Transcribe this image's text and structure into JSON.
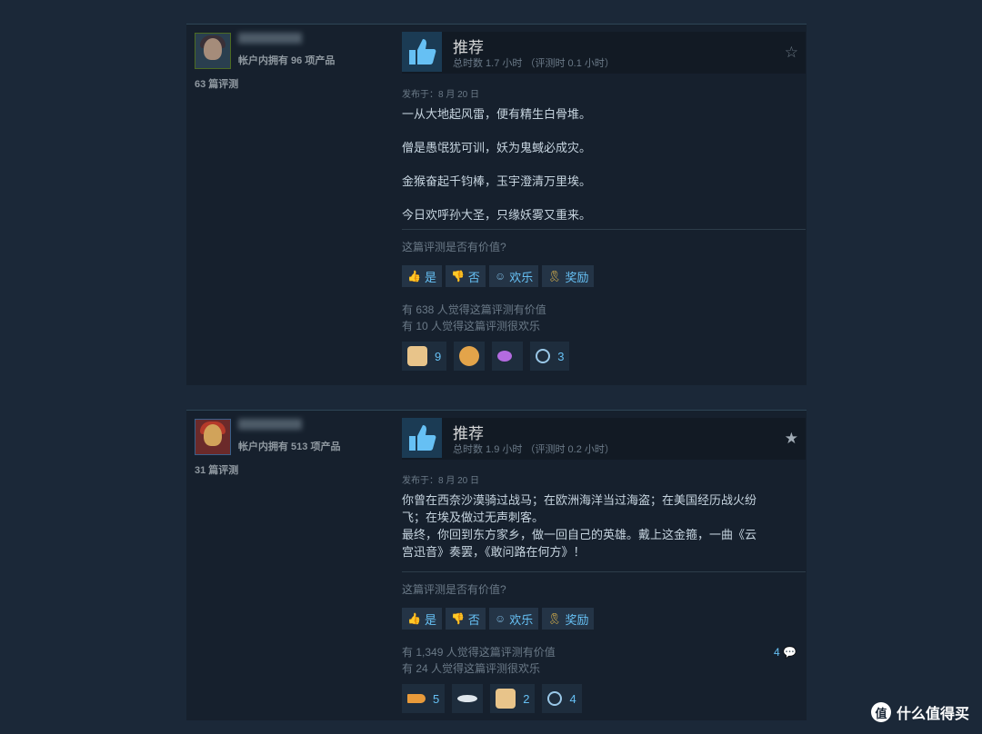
{
  "reviews": [
    {
      "owned": "帐户内拥有 96 项产品",
      "review_count": "63 篇评测",
      "verdict": "推荐",
      "hours": "总时数 1.7 小时 （评测时 0.1 小时）",
      "posted": "发布于：8 月 20 日",
      "lines": [
        "一从大地起风雷，便有精生白骨堆。",
        "僧是愚氓犹可训，妖为鬼蜮必成灾。",
        "金猴奋起千钧棒，玉宇澄清万里埃。",
        "今日欢呼孙大圣，只缘妖雾又重来。"
      ],
      "helpful_question": "这篇评测是否有价值?",
      "yes": "是",
      "no": "否",
      "funny": "欢乐",
      "award": "奖励",
      "helpful_stat": "有 638 人觉得这篇评测有价值",
      "funny_stat": "有 10 人觉得这篇评测很欢乐",
      "awards": [
        "9",
        "",
        "",
        "3"
      ],
      "star": "star-outline-icon"
    },
    {
      "owned": "帐户内拥有 513 项产品",
      "review_count": "31 篇评测",
      "verdict": "推荐",
      "hours": "总时数 1.9 小时 （评测时 0.2 小时）",
      "posted": "发布于：8 月 20 日",
      "lines": [
        "你曾在西奈沙漠骑过战马；在欧洲海洋当过海盗；在美国经历战火纷",
        "飞；在埃及做过无声刺客。",
        "最终，你回到东方家乡，做一回自己的英雄。戴上这金箍，一曲《云",
        "宫迅音》奏罢，《敢问路在何方》！"
      ],
      "helpful_question": "这篇评测是否有价值?",
      "yes": "是",
      "no": "否",
      "funny": "欢乐",
      "award": "奖励",
      "helpful_stat": "有 1,349 人觉得这篇评测有价值",
      "funny_stat": "有 24 人觉得这篇评测很欢乐",
      "comments": "4",
      "awards": [
        "5",
        "",
        "2",
        "4"
      ],
      "star": "star-filled-icon"
    }
  ],
  "watermark": {
    "logo": "值",
    "text": "什么值得买"
  },
  "colors": {
    "background": "#1b2838",
    "panel": "#16202d",
    "link": "#66c0f4"
  }
}
